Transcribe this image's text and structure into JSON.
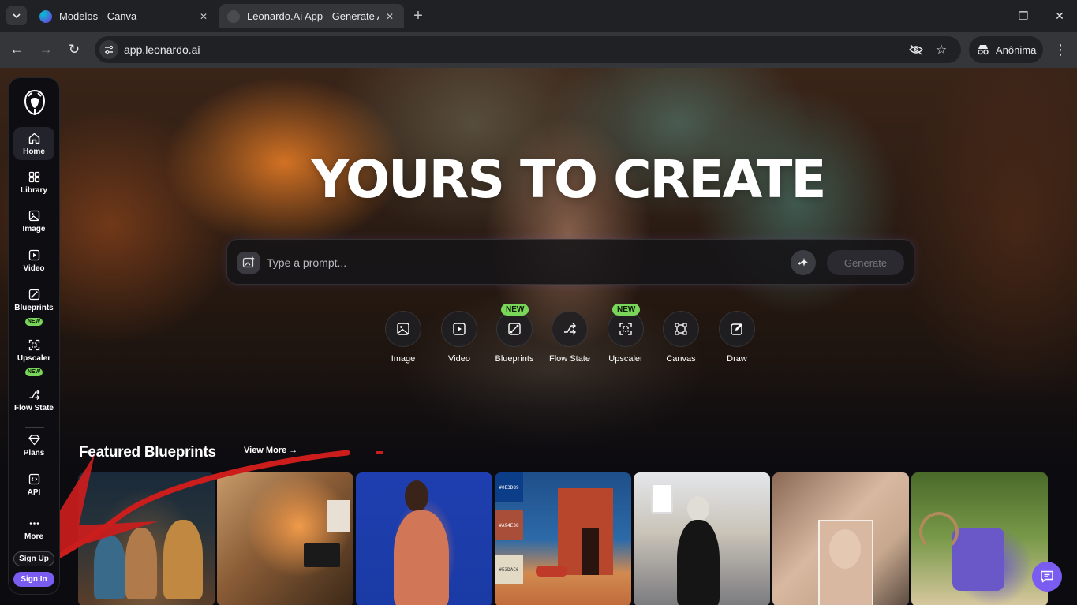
{
  "browser": {
    "tabs": [
      {
        "title": "Modelos - Canva",
        "active": false
      },
      {
        "title": "Leonardo.Ai App - Generate AI I",
        "active": true
      }
    ],
    "url": "app.leonardo.ai",
    "profile_label": "Anônima"
  },
  "sidebar": {
    "items": [
      {
        "label": "Home",
        "icon": "home-icon",
        "active": true,
        "badge": ""
      },
      {
        "label": "Library",
        "icon": "grid-icon",
        "active": false,
        "badge": ""
      },
      {
        "label": "Image",
        "icon": "image-icon",
        "active": false,
        "badge": ""
      },
      {
        "label": "Video",
        "icon": "video-icon",
        "active": false,
        "badge": ""
      },
      {
        "label": "Blueprints",
        "icon": "blueprint-icon",
        "active": false,
        "badge": "NEW"
      },
      {
        "label": "Upscaler",
        "icon": "upscaler-icon",
        "active": false,
        "badge": "NEW"
      },
      {
        "label": "Flow State",
        "icon": "flow-state-icon",
        "active": false,
        "badge": ""
      },
      {
        "label": "Plans",
        "icon": "diamond-icon",
        "active": false,
        "badge": ""
      },
      {
        "label": "API",
        "icon": "code-icon",
        "active": false,
        "badge": ""
      },
      {
        "label": "More",
        "icon": "more-dots-icon",
        "active": false,
        "badge": ""
      }
    ],
    "signup_label": "Sign Up",
    "signin_label": "Sign In"
  },
  "hero": {
    "headline": "YOURS TO CREATE",
    "prompt_placeholder": "Type a prompt...",
    "generate_label": "Generate"
  },
  "quick_actions": [
    {
      "label": "Image",
      "badge": ""
    },
    {
      "label": "Video",
      "badge": ""
    },
    {
      "label": "Blueprints",
      "badge": "NEW"
    },
    {
      "label": "Flow State",
      "badge": ""
    },
    {
      "label": "Upscaler",
      "badge": "NEW"
    },
    {
      "label": "Canvas",
      "badge": ""
    },
    {
      "label": "Draw",
      "badge": ""
    }
  ],
  "featured": {
    "title": "Featured Blueprints",
    "view_more": "View More →",
    "palette_swatches": [
      "#0B3D89",
      "#A94E38",
      "#E3DAC6"
    ]
  },
  "colors": {
    "accent": "#7B5CF0",
    "new_badge": "#7AD65A",
    "annotation": "#CC1D1D"
  }
}
